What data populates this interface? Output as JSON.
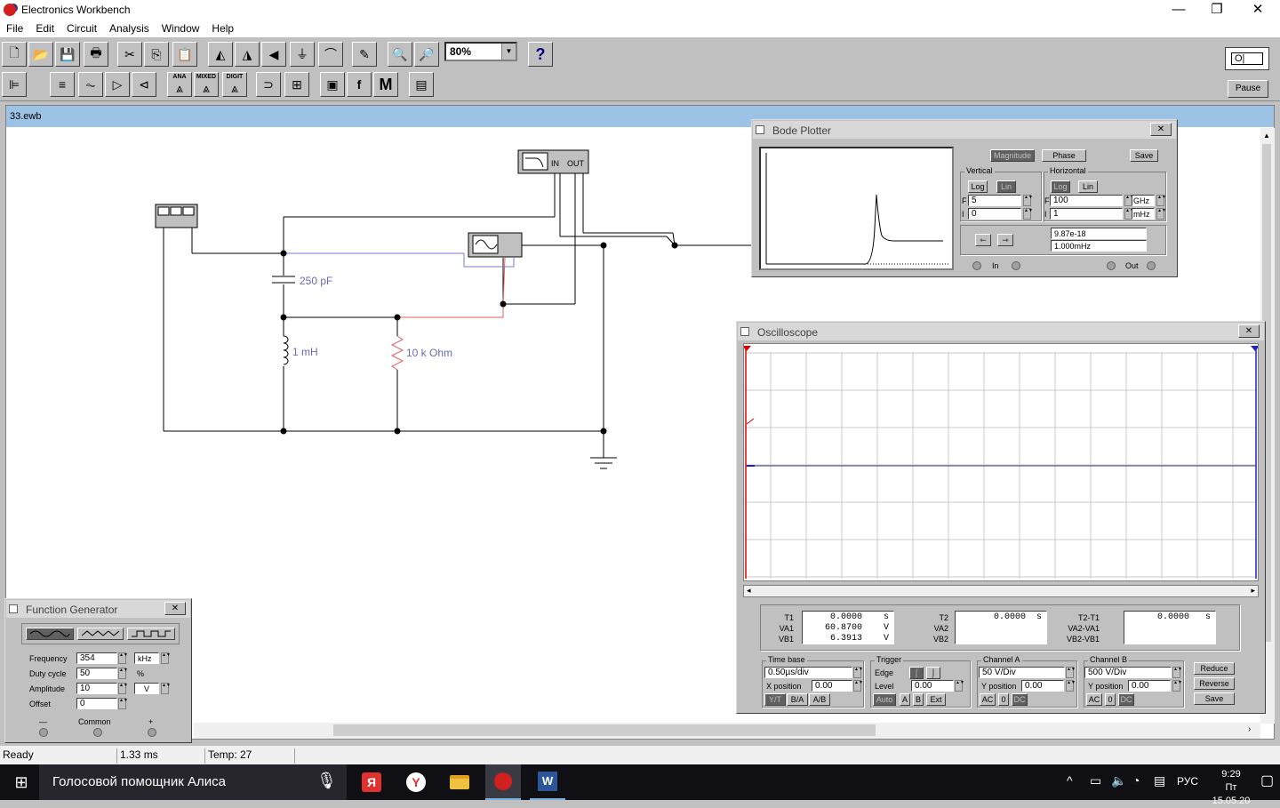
{
  "app": {
    "title": "Electronics Workbench",
    "win_min": "—",
    "win_max": "❐",
    "win_close": "✕"
  },
  "menu": [
    "File",
    "Edit",
    "Circuit",
    "Analysis",
    "Window",
    "Help"
  ],
  "toolbar": {
    "zoom": "80%",
    "help": "?",
    "ana": "ANA",
    "mixed": "MIXED",
    "digit": "DIGIT",
    "pause": "Pause"
  },
  "document": {
    "title": "33.ewb"
  },
  "circuit": {
    "capacitor_label": "250 pF",
    "inductor_label": "1 mH",
    "resistor_label": "10 k Ohm",
    "bode_in": "IN",
    "bode_out": "OUT"
  },
  "bode": {
    "title": "Bode Plotter",
    "magnitude": "Magnitude",
    "phase": "Phase",
    "save": "Save",
    "vertical": "Vertical",
    "horizontal": "Horizontal",
    "log": "Log",
    "lin": "Lin",
    "F": "F",
    "I": "I",
    "v_f": "5",
    "v_i": "0",
    "h_f": "100",
    "h_f_unit": "GHz",
    "h_i": "1",
    "h_i_unit": "mHz",
    "readout_value": "9.87e-18",
    "readout_freq": "1.000mHz",
    "in": "In",
    "out": "Out"
  },
  "scope": {
    "title": "Oscilloscope",
    "t1": "T1",
    "va1": "VA1",
    "vb1": "VB1",
    "t1_val": "0.0000",
    "t1_unit": "s",
    "va1_val": "60.8700",
    "va1_unit": "V",
    "vb1_val": "6.3913",
    "vb1_unit": "V",
    "t2": "T2",
    "va2": "VA2",
    "vb2": "VB2",
    "t2_val": "0.0000",
    "t2_unit": "s",
    "t21": "T2-T1",
    "va21": "VA2-VA1",
    "vb21": "VB2-VB1",
    "t21_val": "0.0000",
    "t21_unit": "s",
    "timebase": "Time base",
    "timebase_val": "0.50µs/div",
    "xpos": "X position",
    "xpos_val": "0.00",
    "yt": "Y/T",
    "ba": "B/A",
    "ab": "A/B",
    "trigger": "Trigger",
    "edge": "Edge",
    "level": "Level",
    "level_val": "0.00",
    "auto": "Auto",
    "a": "A",
    "b": "B",
    "ext": "Ext",
    "chA": "Channel A",
    "chA_val": "50  V/Div",
    "ypos": "Y position",
    "chA_ypos": "0.00",
    "chB": "Channel B",
    "chB_val": "500  V/Div",
    "chB_ypos": "0.00",
    "ac": "AC",
    "zero": "0",
    "dc": "DC",
    "reduce": "Reduce",
    "reverse": "Reverse",
    "save": "Save"
  },
  "fgen": {
    "title": "Function Generator",
    "frequency": "Frequency",
    "frequency_val": "354",
    "frequency_unit": "kHz",
    "duty": "Duty cycle",
    "duty_val": "50",
    "duty_unit": "%",
    "amplitude": "Amplitude",
    "amplitude_val": "10",
    "amplitude_unit": "V",
    "offset": "Offset",
    "offset_val": "0",
    "minus": "—",
    "common": "Common",
    "plus": "+"
  },
  "status": {
    "ready": "Ready",
    "time": "1.33 ms",
    "temp": "Temp:  27"
  },
  "taskbar": {
    "assistant": "Голосовой помощник Алиса",
    "lang": "РУС",
    "clock_time": "9:29",
    "clock_date": "Пт 15.05.20"
  },
  "colors": {
    "accent": "#9cc2e6",
    "wire_blue": "#7b7bd6",
    "wire_red": "#e06060",
    "label": "#6a6ab8"
  }
}
